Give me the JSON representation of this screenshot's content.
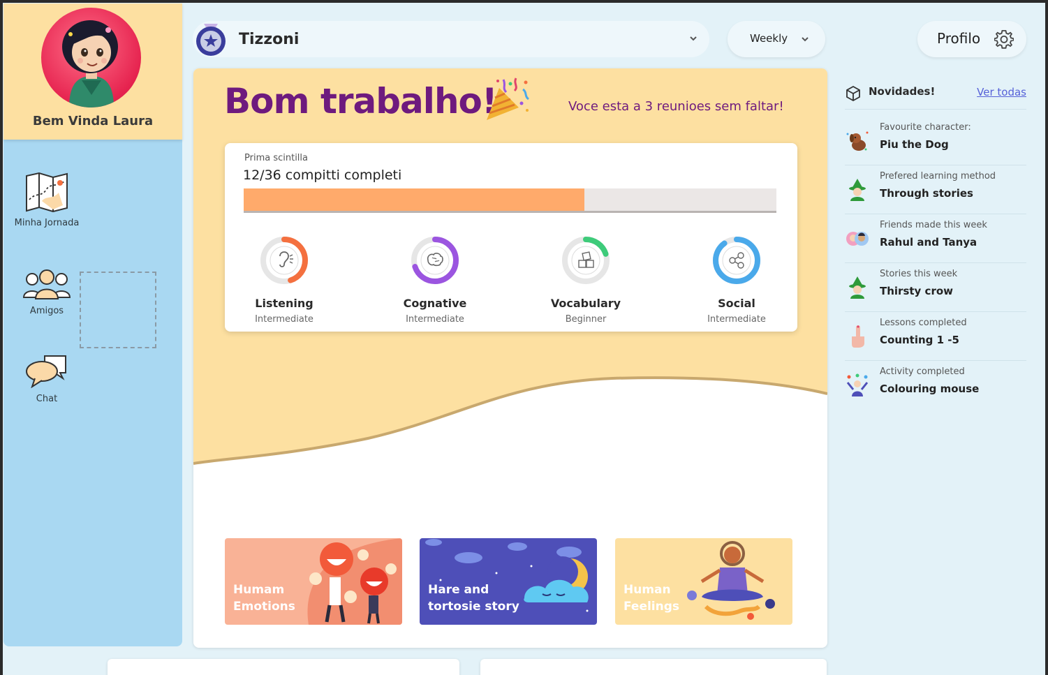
{
  "user": {
    "welcome": "Bem Vinda Laura"
  },
  "nav": [
    {
      "label": "Minha Jornada",
      "icon": "map-icon"
    },
    {
      "label": "Amigos",
      "icon": "friends-icon"
    },
    {
      "label": "Chat",
      "icon": "chat-bubbles-icon"
    }
  ],
  "header": {
    "team_name": "Tizzoni",
    "period": "Weekly",
    "profile_label": "Profilo"
  },
  "hero": {
    "headline": "Bom trabalho!",
    "streak": "Voce esta a 3 reunioes sem faltar!"
  },
  "progress": {
    "subtitle": "Prima scintilla",
    "title": "12/36 compitti completi",
    "completed": 12,
    "total": 36,
    "bar_fraction": 0.64,
    "bar_color": "#ffaa6b"
  },
  "skills": [
    {
      "name": "Listening",
      "level": "Intermediate",
      "fraction": 0.45,
      "color": "#f4703f",
      "icon": "ear-icon"
    },
    {
      "name": "Cognative",
      "level": "Intermediate",
      "fraction": 0.7,
      "color": "#9b55e0",
      "icon": "brain-icon"
    },
    {
      "name": "Vocabulary",
      "level": "Beginner",
      "fraction": 0.2,
      "color": "#3ecb7a",
      "icon": "blocks-icon"
    },
    {
      "name": "Social",
      "level": "Intermediate",
      "fraction": 0.9,
      "color": "#4aa9ea",
      "icon": "network-icon"
    }
  ],
  "stories": [
    {
      "title": "Humam Emotions",
      "bg": "#f9b296",
      "text_color": "#ffffff"
    },
    {
      "title": "Hare and tortosie story",
      "bg": "#4e4fb8",
      "text_color": "#ffffff"
    },
    {
      "title": "Human Feelings",
      "bg": "#fde0a1",
      "text_color": "#ffffff"
    }
  ],
  "news": {
    "title": "Novidades!",
    "see_all": "Ver todas",
    "items": [
      {
        "caption": "Favourite character:",
        "value": "Piu the Dog",
        "icon": "dog-icon"
      },
      {
        "caption": "Prefered learning method",
        "value": "Through stories",
        "icon": "wizard-icon"
      },
      {
        "caption": "Friends made this week",
        "value": "Rahul and Tanya",
        "icon": "friends-avatars-icon"
      },
      {
        "caption": "Stories this week",
        "value": "Thirsty  crow",
        "icon": "wizard-icon"
      },
      {
        "caption": "Lessons completed",
        "value": "Counting 1 -5",
        "icon": "finger-icon"
      },
      {
        "caption": "Activity completed",
        "value": "Colouring mouse",
        "icon": "juggler-icon"
      }
    ]
  },
  "colors": {
    "accent_purple": "#6e1a7e",
    "sidebar_blue": "#a9d8f2",
    "cream": "#fde0a1",
    "link_blue": "#5661d8"
  }
}
